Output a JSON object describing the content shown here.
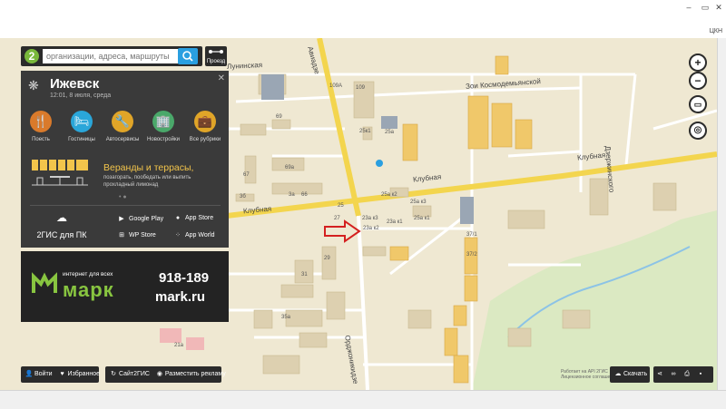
{
  "search": {
    "placeholder": "организации, адреса, маршруты"
  },
  "route_button": {
    "label": "Проезд"
  },
  "city_panel": {
    "title": "Ижевск",
    "subtitle": "12:01, 8 июля, среда",
    "categories": [
      {
        "label": "Поесть",
        "icon": "fork-knife-icon",
        "color": "#d97a2b",
        "glyph": "🍴"
      },
      {
        "label": "Гостиницы",
        "icon": "bed-icon",
        "color": "#2aa6d9",
        "glyph": "🛏"
      },
      {
        "label": "Автосервисы",
        "icon": "wrench-icon",
        "color": "#e0a528",
        "glyph": "🔧"
      },
      {
        "label": "Новостройки",
        "icon": "building-icon",
        "color": "#4aa86a",
        "glyph": "🏢"
      },
      {
        "label": "Все рубрики",
        "icon": "briefcase-icon",
        "color": "#e0a528",
        "glyph": "💼"
      }
    ],
    "promo": {
      "title": "Веранды и террасы,",
      "subtitle": "позагорать, пообедать или выпить прохладный лимонад"
    },
    "downloads": {
      "pc_label": "2ГИС для ПК",
      "stores": [
        "Google Play",
        "App Store",
        "WP Store",
        "App World"
      ]
    }
  },
  "ad": {
    "slogan": "интернет для всех",
    "brand": "марк",
    "phone": "918-189",
    "site": "mark.ru"
  },
  "bottom_bar": {
    "login": "Войти",
    "favorites": "Избранное",
    "site": "Сайт2ГИС",
    "advertise": "Разместить рекламу",
    "download": "Скачать"
  },
  "attribution": {
    "line1": "Работает на API 2ГИС",
    "line2": "Лицензионное соглашение"
  },
  "map": {
    "streets": [
      "Клубная",
      "Клубная",
      "Зои Космодемьянской",
      "Орджоникидзе",
      "Дзержинского",
      "Клубная"
    ],
    "buildings": [
      "109А",
      "109",
      "25к1",
      "25а",
      "25а к2",
      "25а к3",
      "25а к1",
      "25",
      "27",
      "23а к3",
      "23а к2",
      "23а к1",
      "69",
      "69а",
      "67",
      "66",
      "3а",
      "3б",
      "37/1",
      "37/2",
      "29",
      "31",
      "35а",
      "21а"
    ],
    "partial_labels": [
      "Лунинская",
      "Авиадзе"
    ]
  },
  "window": {
    "corner_label": "ЦКН"
  }
}
